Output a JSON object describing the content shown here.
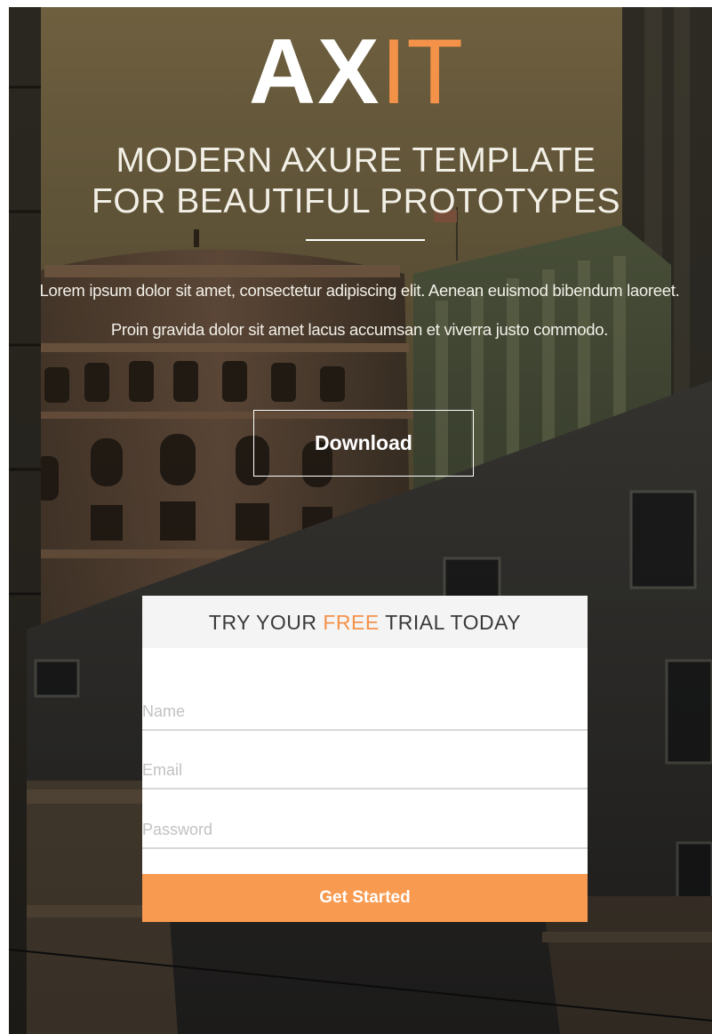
{
  "hero": {
    "logo_primary": "AX",
    "logo_accent": "IT",
    "headline_line1": "MODERN AXURE TEMPLATE",
    "headline_line2": "FOR BEAUTIFUL PROTOTYPES",
    "lede": "Lorem ipsum dolor sit amet, consectetur adipiscing elit. Aenean euismod bibendum laoreet. Proin gravida dolor sit amet lacus accumsan et viverra justo commodo.",
    "download_label": "Download"
  },
  "trial_form": {
    "title_before": "TRY YOUR ",
    "title_highlight": "FREE",
    "title_after": " TRIAL TODAY",
    "name_placeholder": "Name",
    "email_placeholder": "Email",
    "password_placeholder": "Password",
    "submit_label": "Get Started"
  },
  "colors": {
    "accent": "#f4924a",
    "button": "#f89a4f",
    "card_header": "#f4f4f4"
  }
}
